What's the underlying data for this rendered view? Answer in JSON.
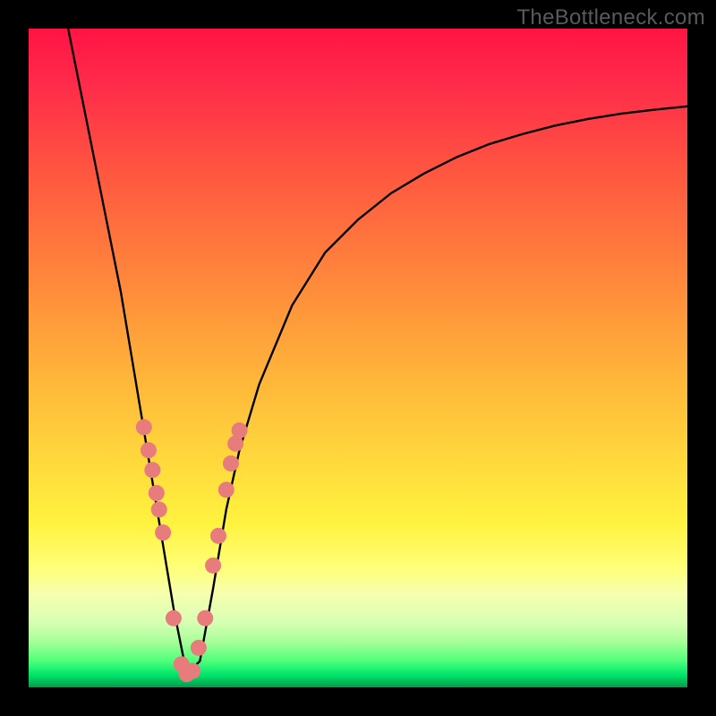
{
  "watermark": "TheBottleneck.com",
  "chart_data": {
    "type": "line",
    "title": "",
    "xlabel": "",
    "ylabel": "",
    "xlim": [
      0,
      100
    ],
    "ylim": [
      0,
      100
    ],
    "background": "rainbow-gradient-vertical",
    "description": "V-shaped bottleneck curve: steep descent on the left side, a minimum around x≈24, steep ascent after the minimum which gradually flattens toward the right. Pink dots cluster on both arms near the bottom of the V.",
    "series": [
      {
        "name": "bottleneck-curve",
        "x": [
          6,
          8,
          10,
          12,
          14,
          16,
          18,
          20,
          22,
          24,
          26,
          28,
          30,
          32,
          35,
          40,
          45,
          50,
          55,
          60,
          65,
          70,
          75,
          80,
          85,
          90,
          95,
          100
        ],
        "y": [
          100,
          90,
          80,
          70,
          60,
          48,
          36,
          24,
          12,
          2,
          4,
          15,
          27,
          36,
          46,
          58,
          66,
          71,
          75,
          78,
          80.5,
          82.5,
          84,
          85.3,
          86.3,
          87.1,
          87.7,
          88.2
        ]
      },
      {
        "name": "dots",
        "type": "scatter",
        "color": "#e87b7b",
        "x": [
          17.5,
          18.2,
          18.8,
          19.4,
          19.8,
          20.4,
          22.0,
          23.2,
          24.0,
          24.9,
          25.8,
          26.8,
          28.0,
          28.8,
          30.0,
          30.7,
          31.4,
          32.0
        ],
        "y": [
          39.5,
          36.0,
          33.0,
          29.5,
          27.0,
          23.5,
          10.5,
          3.5,
          2.0,
          2.5,
          6.0,
          10.5,
          18.5,
          23.0,
          30.0,
          34.0,
          37.0,
          39.0
        ]
      }
    ]
  }
}
